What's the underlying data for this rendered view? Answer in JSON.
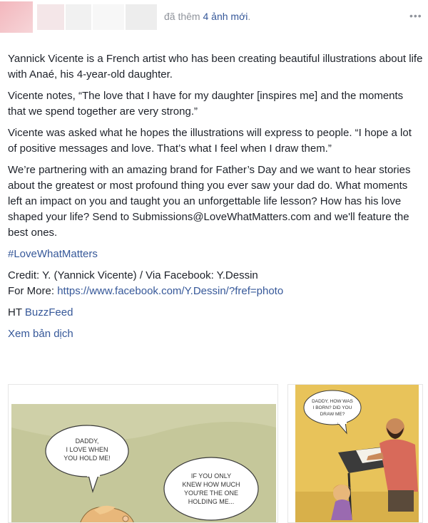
{
  "header": {
    "action_prefix": "đã thêm",
    "action_link": "4 ảnh mới",
    "action_suffix": ".",
    "more_glyph": "•••"
  },
  "post": {
    "paragraphs": [
      "Yannick Vicente is a French artist who has been creating beautiful illustrations about life with Anaé, his 4-year-old daughter.",
      "Vicente notes, “The love that I have for my daughter [inspires me] and the moments that we spend together are very strong.”",
      "Vicente was asked what he hopes the illustrations will express to people. “I hope a lot of positive messages and love. That’s what I feel when I draw them.”",
      "We’re partnering with an amazing brand for Father’s Day and we want to hear stories about the greatest or most profound thing you ever saw your dad do. What moments left an impact on you and taught you an unforgettable life lesson? How has his love shaped your life? Send to Submissions@LoveWhatMatters.com and we'll feature the best ones."
    ],
    "hashtag": "#LoveWhatMatters",
    "credit_line": "Credit: Y. (Yannick Vicente) / Via Facebook: Y.Dessin",
    "for_more_label": "For More: ",
    "for_more_url": "https://www.facebook.com/Y.Dessin/?fref=photo",
    "ht_label": "HT ",
    "ht_source": "BuzzFeed",
    "translate": "Xem bản dịch"
  },
  "photos": {
    "a": {
      "bubble1": [
        "DADDY,",
        "I LOVE WHEN",
        "YOU HOLD ME!"
      ],
      "bubble2": [
        "IF YOU ONLY",
        "KNEW HOW MUCH",
        "YOU'RE THE ONE",
        "HOLDING ME..."
      ]
    },
    "b": {
      "bubble": [
        "DADDY, HOW WAS",
        "I BORN? DID YOU",
        "DRAW ME?"
      ]
    }
  },
  "colors": {
    "link": "#365899",
    "meta": "#90949c",
    "text": "#1d2129",
    "comic_bg": "#c5c79a"
  }
}
